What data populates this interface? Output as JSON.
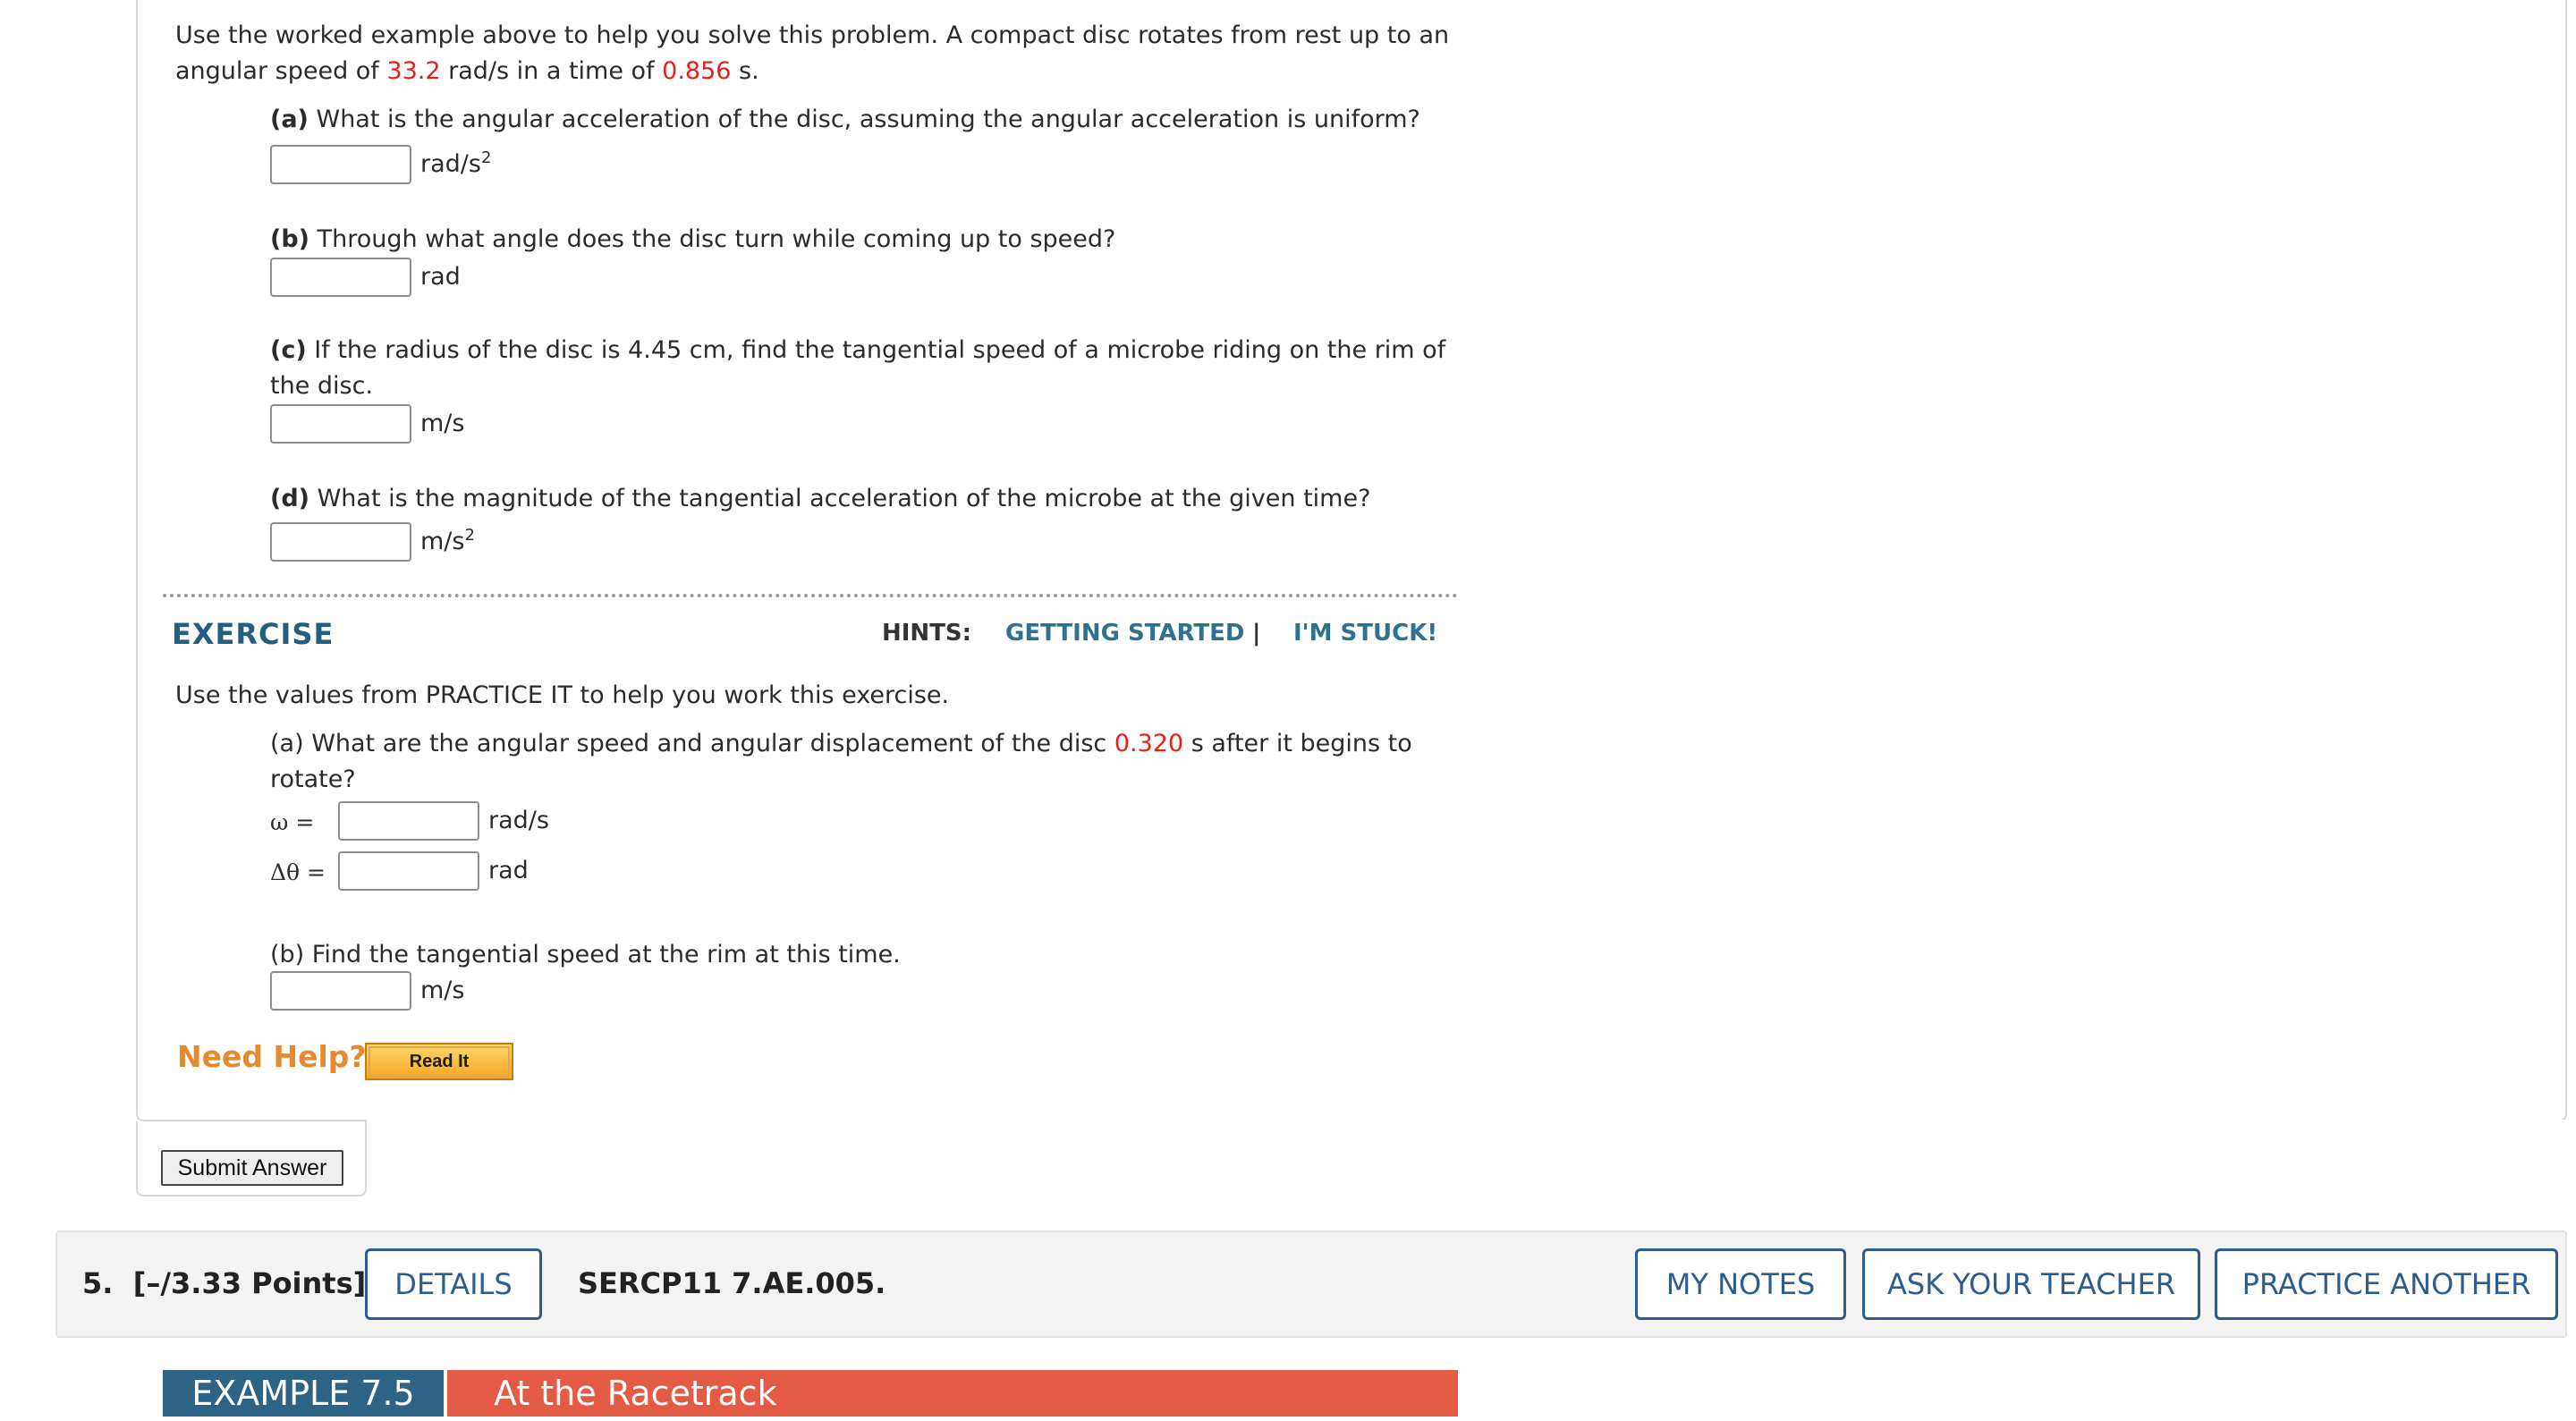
{
  "practice": {
    "intro_before_speed": "Use the worked example above to help you solve this problem. A compact disc rotates from rest up to an",
    "intro_line2_pre": "angular speed of ",
    "speed_value": "33.2",
    "intro_line2_mid": " rad/s in a time of ",
    "time_value": "0.856",
    "intro_line2_post": " s.",
    "parts": [
      {
        "label": "(a)",
        "question": "What is the angular acceleration of the disc, assuming the angular acceleration is uniform?",
        "unit": "rad/s",
        "unit_sup": "2",
        "value": ""
      },
      {
        "label": "(b)",
        "question": "Through what angle does the disc turn while coming up to speed?",
        "unit": "rad",
        "unit_sup": "",
        "value": ""
      },
      {
        "label": "(c)",
        "question_line1": "If the radius of the disc is 4.45 cm, find the tangential speed of a microbe riding on the rim of",
        "question_line2": "the disc.",
        "unit": "m/s",
        "unit_sup": "",
        "value": ""
      },
      {
        "label": "(d)",
        "question": "What is the magnitude of the tangential acceleration of the microbe at the given time?",
        "unit": "m/s",
        "unit_sup": "2",
        "value": ""
      }
    ]
  },
  "exercise": {
    "title": "EXERCISE",
    "hints_label": "HINTS:",
    "hint_getting_started": "GETTING STARTED",
    "hint_sep": "|",
    "hint_stuck": "I'M STUCK!",
    "intro": "Use the values from PRACTICE IT to help you work this exercise.",
    "part_a_line1_pre": "(a) What are the angular speed and angular displacement of the disc ",
    "part_a_time": "0.320",
    "part_a_line1_post": " s after it begins to",
    "part_a_line2": "rotate?",
    "omega_label": "ω =",
    "omega_unit": "rad/s",
    "theta_label": "Δθ =",
    "theta_unit": "rad",
    "part_b": "(b) Find the tangential speed at the rim at this time.",
    "part_b_unit": "m/s"
  },
  "help": {
    "need_help": "Need Help?",
    "read_it": "Read It"
  },
  "submit_label": "Submit Answer",
  "next_question": {
    "number": "5.",
    "points": "[–/3.33 Points]",
    "details": "DETAILS",
    "code": "SERCP11 7.AE.005.",
    "my_notes": "MY NOTES",
    "ask_teacher": "ASK YOUR TEACHER",
    "practice_another": "PRACTICE ANOTHER"
  },
  "example": {
    "number": "EXAMPLE 7.5",
    "title": "At the Racetrack"
  }
}
